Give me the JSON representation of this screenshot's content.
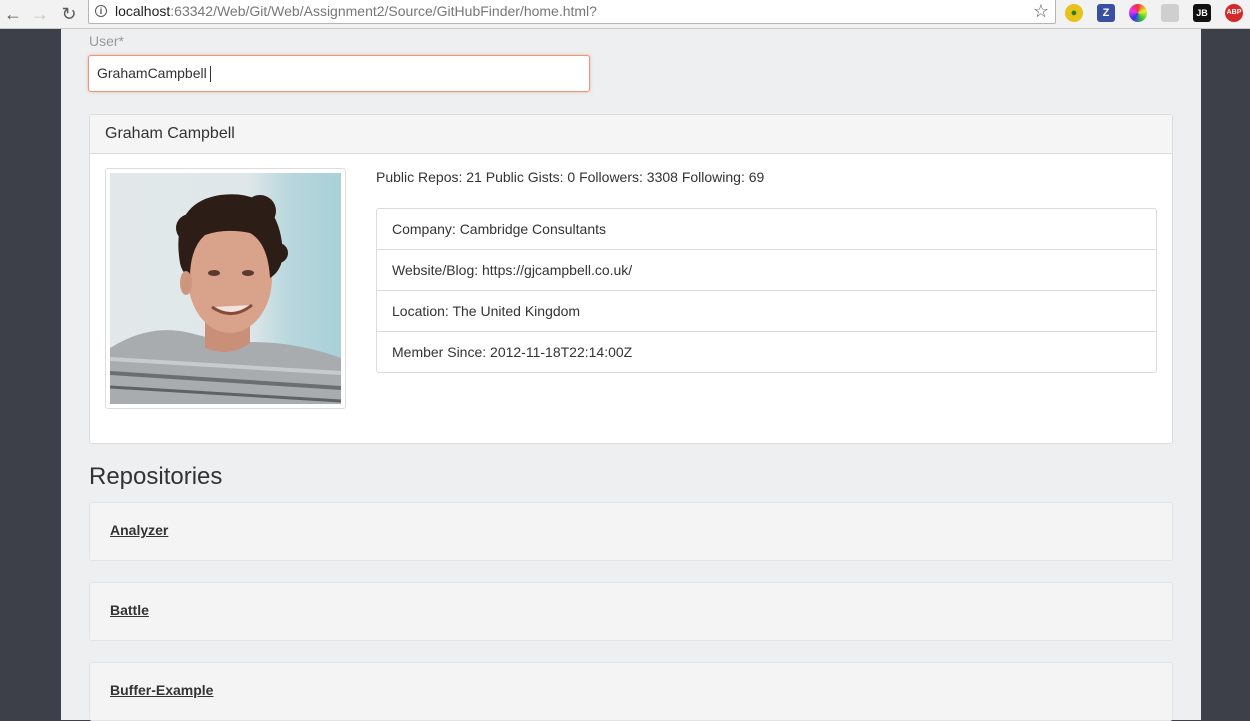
{
  "browser": {
    "url_host": "localhost",
    "url_rest": ":63342/Web/Git/Web/Assignment2/Source/GitHubFinder/home.html?"
  },
  "search": {
    "label": "User*",
    "value": "GrahamCampbell"
  },
  "profile": {
    "name": "Graham Campbell",
    "stats": "Public Repos: 21 Public Gists: 0 Followers: 3308 Following: 69",
    "details": [
      "Company: Cambridge Consultants",
      "Website/Blog: https://gjcampbell.co.uk/",
      "Location: The United Kingdom",
      "Member Since: 2012-11-18T22:14:00Z"
    ]
  },
  "repositories": {
    "title": "Repositories",
    "items": [
      "Analyzer",
      "Battle",
      "Buffer-Example"
    ]
  },
  "colors": {
    "input_border": "#e9967a",
    "sidebar_bg": "#3e4049",
    "page_bg": "#eeeff1"
  }
}
